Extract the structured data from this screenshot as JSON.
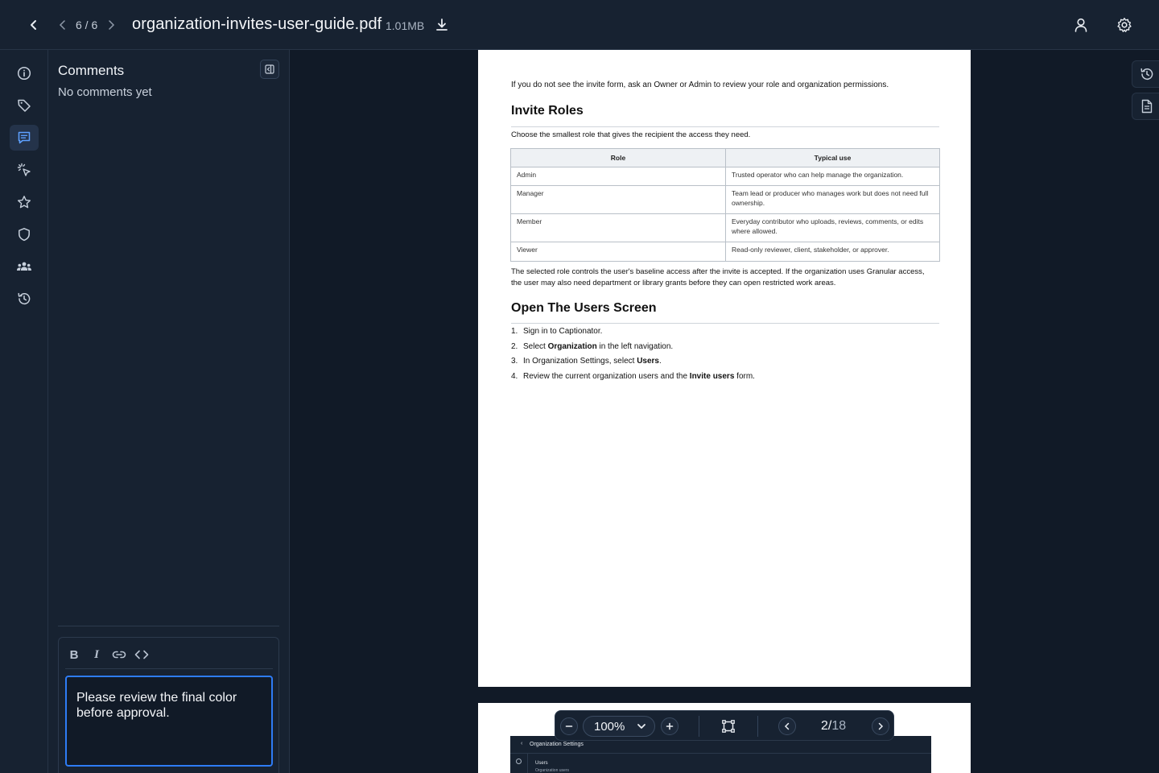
{
  "topbar": {
    "counter": "6 / 6",
    "filename": "organization-invites-user-guide.pdf",
    "filesize": "1.01MB"
  },
  "rail": {
    "items": [
      {
        "icon": "info-icon"
      },
      {
        "icon": "tag-icon"
      },
      {
        "icon": "comment-icon",
        "active": true
      },
      {
        "icon": "sparkle-pointer-icon"
      },
      {
        "icon": "star-icon"
      },
      {
        "icon": "shield-icon"
      },
      {
        "icon": "team-icon"
      },
      {
        "icon": "history-icon"
      }
    ]
  },
  "comments": {
    "title": "Comments",
    "empty_text": "No comments yet",
    "draft": "Please review the final color before approval.",
    "toolbar": {
      "bold": "B",
      "italic": "I"
    }
  },
  "document": {
    "intro": "If you do not see the invite form, ask an Owner or Admin to review your role and organization permissions.",
    "section1_title": "Invite Roles",
    "section1_text": "Choose the smallest role that gives the recipient the access they need.",
    "table": {
      "headers": [
        "Role",
        "Typical use"
      ],
      "rows": [
        [
          "Admin",
          "Trusted operator who can help manage the organization."
        ],
        [
          "Manager",
          "Team lead or producer who manages work but does not need full ownership."
        ],
        [
          "Member",
          "Everyday contributor who uploads, reviews, comments, or edits where allowed."
        ],
        [
          "Viewer",
          "Read-only reviewer, client, stakeholder, or approver."
        ]
      ]
    },
    "section1_after": "The selected role controls the user's baseline access after the invite is accepted. If the organization uses Granular access, the user may also need department or library grants before they can open restricted work areas.",
    "section2_title": "Open The Users Screen",
    "steps": [
      {
        "n": "1.",
        "pre": "Sign in to Captionator.",
        "bold": "",
        "post": ""
      },
      {
        "n": "2.",
        "pre": "Select ",
        "bold": "Organization",
        "post": " in the left navigation."
      },
      {
        "n": "3.",
        "pre": "In Organization Settings, select ",
        "bold": "Users",
        "post": "."
      },
      {
        "n": "4.",
        "pre": "Review the current organization users and the ",
        "bold": "Invite users",
        "post": " form."
      }
    ],
    "page2": {
      "mini_back": "‹",
      "mini_title": "Organization Settings",
      "mini_users": "Users",
      "mini_sub": "Organization users"
    }
  },
  "zoombar": {
    "zoom": "100%",
    "page_current": "2",
    "page_total": "18"
  },
  "colors": {
    "accent": "#2e7cf6",
    "background": "#111a27",
    "panel": "#172231"
  }
}
